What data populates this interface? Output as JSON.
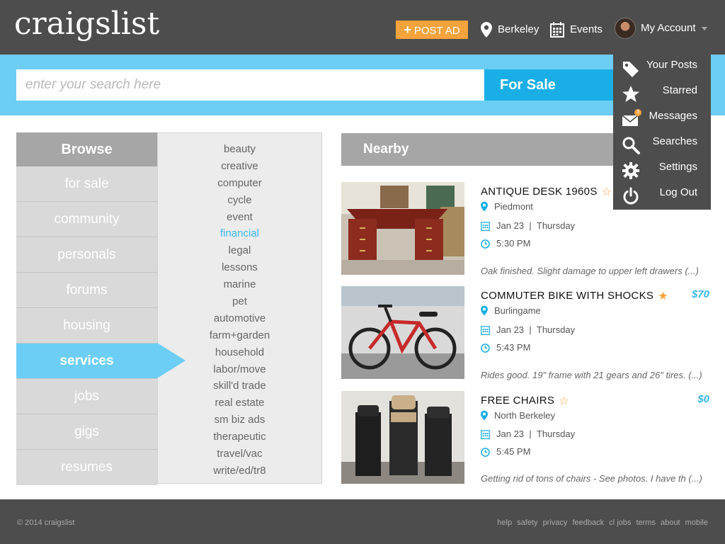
{
  "header": {
    "logo": "craigslist",
    "post_ad": "POST AD",
    "post_ad_plus": "+",
    "location": "Berkeley",
    "events": "Events",
    "account": "My Account"
  },
  "search": {
    "placeholder": "enter your search here",
    "category": "For Sale"
  },
  "browse": {
    "title": "Browse",
    "items": [
      "for sale",
      "community",
      "personals",
      "forums",
      "housing",
      "services",
      "jobs",
      "gigs",
      "resumes"
    ],
    "active": "services"
  },
  "subcategories": {
    "items": [
      "beauty",
      "creative",
      "computer",
      "cycle",
      "event",
      "financial",
      "legal",
      "lessons",
      "marine",
      "pet",
      "automotive",
      "farm+garden",
      "household",
      "labor/move",
      "skill'd trade",
      "real estate",
      "sm biz ads",
      "therapeutic",
      "travel/vac",
      "write/ed/tr8"
    ],
    "active": "financial"
  },
  "nearby": {
    "title": "Nearby",
    "listings": [
      {
        "title": "ANTIQUE DESK 1960S",
        "starred": false,
        "price": "",
        "location": "Piedmont",
        "date": "Jan 23",
        "day": "Thursday",
        "time": "5:30 PM",
        "description": "Oak finished. Slight damage to upper left drawers (...)"
      },
      {
        "title": "COMMUTER BIKE WITH SHOCKS",
        "starred": true,
        "price": "$70",
        "location": "Burlingame",
        "date": "Jan 23",
        "day": "Thursday",
        "time": "5:43 PM",
        "description": "Rides good. 19\" frame with 21 gears and 26\" tires. (...)"
      },
      {
        "title": "FREE CHAIRS",
        "starred": false,
        "price": "$0",
        "location": "North Berkeley",
        "date": "Jan 23",
        "day": "Thursday",
        "time": "5:45 PM",
        "description": "Getting rid of tons of chairs - See photos. I have th (...)"
      }
    ]
  },
  "account_menu": {
    "items": [
      {
        "label": "Your Posts",
        "icon": "tag-icon"
      },
      {
        "label": "Starred",
        "icon": "star-icon"
      },
      {
        "label": "Messages",
        "icon": "envelope-icon",
        "badge": "3"
      },
      {
        "label": "Searches",
        "icon": "search-icon"
      },
      {
        "label": "Settings",
        "icon": "gear-icon"
      },
      {
        "label": "Log Out",
        "icon": "power-icon"
      }
    ]
  },
  "footer": {
    "copyright": "© 2014 craigslist",
    "links": [
      "help",
      "safety",
      "privacy",
      "feedback",
      "cl jobs",
      "terms",
      "about",
      "mobile"
    ]
  },
  "colors": {
    "header_bg": "#4d4d4d",
    "accent_blue": "#6dcef5",
    "select_blue": "#1aaee6",
    "accent_orange": "#f5a33c",
    "link_blue": "#39b7e8"
  }
}
